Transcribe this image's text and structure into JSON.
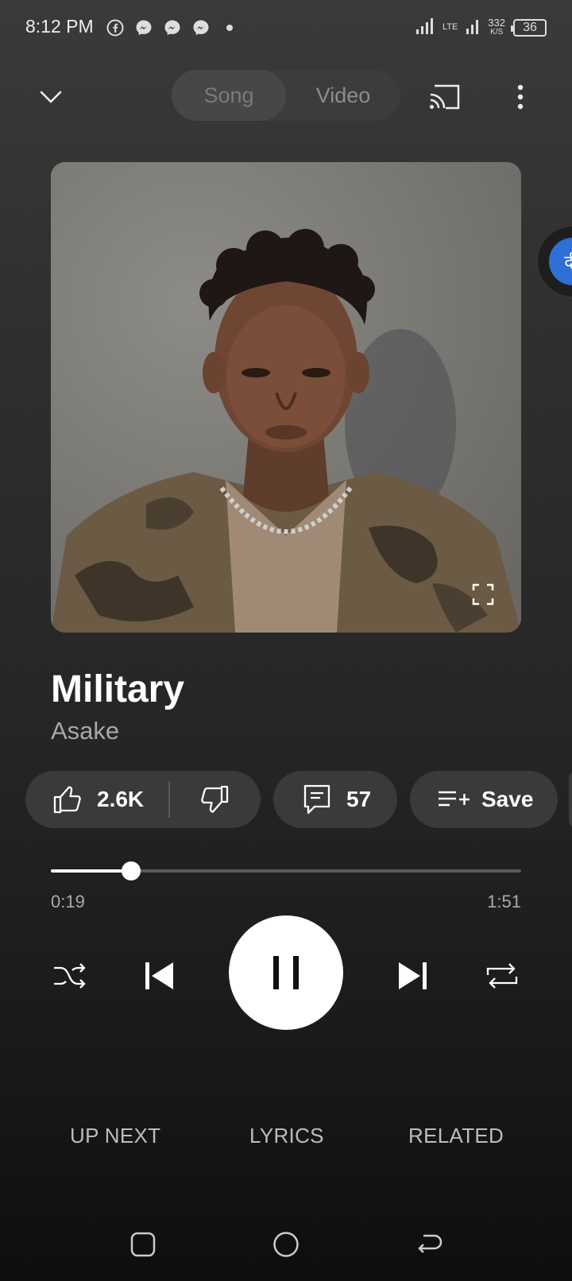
{
  "status_bar": {
    "time": "8:12 PM",
    "net_speed": "332",
    "net_unit": "K/S",
    "lte": "LTE",
    "battery": "36",
    "icons": [
      "facebook-icon",
      "messenger-icon",
      "messenger-icon",
      "messenger-icon",
      "dot-icon",
      "signal-icon",
      "lte-signal-icon",
      "battery-icon"
    ]
  },
  "header": {
    "toggle": {
      "song": "Song",
      "video": "Video",
      "active": "Song"
    },
    "icons": [
      "chevron-down-icon",
      "cast-icon",
      "more-vert-icon"
    ]
  },
  "floating_bubble": {
    "glyph": "दी"
  },
  "track": {
    "title": "Military",
    "artist": "Asake"
  },
  "actions": {
    "like_count": "2.6K",
    "comment_count": "57",
    "save_label": "Save"
  },
  "progress": {
    "current": "0:19",
    "total": "1:51",
    "fraction": 0.171
  },
  "tabs": {
    "up_next": "UP NEXT",
    "lyrics": "LYRICS",
    "related": "RELATED"
  },
  "colors": {
    "background": "#2f2f2f",
    "chip": "#3a3a3a",
    "accent": "#ffffff",
    "muted": "#a8a8a8"
  }
}
